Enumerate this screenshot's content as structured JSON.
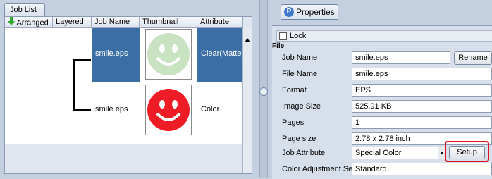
{
  "left": {
    "tab_label": "Job List",
    "columns": [
      "Arranged",
      "Layered",
      "Job Name",
      "Thumbnail",
      "Attribute"
    ],
    "rows": [
      {
        "job_name": "smile.eps",
        "attribute": "Clear(Matte)",
        "thumb_color": "#c8e2c2",
        "selected": true
      },
      {
        "job_name": "smile.eps",
        "attribute": "Color",
        "thumb_color": "#ee1c24",
        "selected": false
      }
    ],
    "arrow_icon": "green-down-arrow-icon"
  },
  "right": {
    "tab_label": "Properties",
    "lock_label": "Lock",
    "section": "File",
    "props": {
      "job_name": {
        "label": "Job Name",
        "value": "smile.eps"
      },
      "file_name": {
        "label": "File Name",
        "value": "smile.eps"
      },
      "format": {
        "label": "Format",
        "value": "EPS"
      },
      "image_size": {
        "label": "Image Size",
        "value": "525.91 KB"
      },
      "pages": {
        "label": "Pages",
        "value": "1"
      },
      "page_size": {
        "label": "Page size",
        "value": "2.78 x 2.78 inch"
      },
      "job_attribute": {
        "label": "Job Attribute",
        "value": "Special Color"
      },
      "color_adjust": {
        "label": "Color Adjustment Set",
        "value": "Standard"
      }
    },
    "rename_label": "Rename",
    "setup_label": "Setup"
  },
  "colors": {
    "selection": "#3a6ea5",
    "highlight": "#e0101f"
  }
}
